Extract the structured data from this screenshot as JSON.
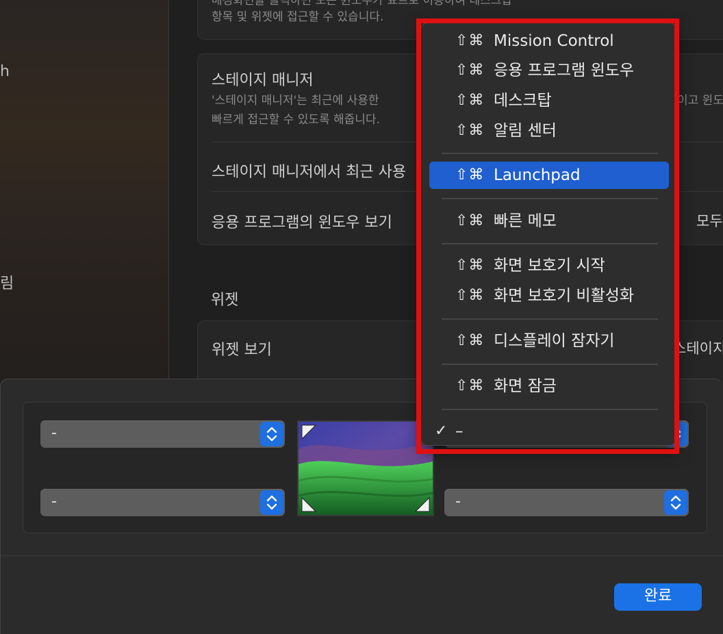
{
  "sidebar": {
    "fragments": [
      "h",
      "림"
    ]
  },
  "settings": {
    "top_group_desc_lines": [
      "배경화면을 클릭하면 모든 윈도우가 표트로 이동하여 데스크탑",
      "항목 및 위젯에 접근할 수 있습니다."
    ],
    "stage_manager": {
      "title": "스테이지 매니저",
      "desc_lines": [
        "'스테이지 매니저'는 최근에 사용한",
        "빠르게 접근할 수 있도록 해줍니다."
      ],
      "desc_tail": "이고 윈도",
      "row1_label": "스테이지 매니저에서 최근 사용",
      "row2_label": "응용 프로그램의 윈도우 보기",
      "row2_value": "모두"
    },
    "widgets": {
      "section_title": "위젯",
      "row_label": "위젯 보기",
      "row_value": "스테이지"
    }
  },
  "sheet": {
    "corners": {
      "top_left": "-",
      "bottom_left": "-",
      "bottom_right": "-"
    },
    "done_label": "완료"
  },
  "menu": {
    "modifiers": "⇧⌘",
    "items": [
      "Mission Control",
      "응용 프로그램 윈도우",
      "데스크탑",
      "알림 센터",
      "Launchpad",
      "빠른 메모",
      "화면 보호기 시작",
      "화면 보호기 비활성화",
      "디스플레이 잠자기",
      "화면 잠금"
    ],
    "selected_item": "Launchpad",
    "checked_item_label": "–",
    "checkmark": "✓"
  },
  "colors": {
    "accent": "#1f6fe0",
    "highlight_frame": "#e01010",
    "menu_selected": "#1f5fcf"
  }
}
